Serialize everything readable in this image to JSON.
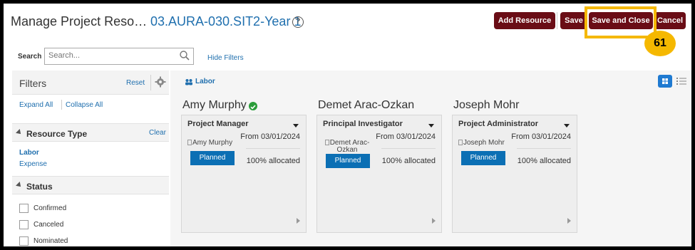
{
  "header": {
    "title": "Manage Project Reso…",
    "project": "03.AURA-030.SIT2-Year 1",
    "help_glyph": "?",
    "buttons": {
      "add_resource": "Add Resource",
      "save": "Save",
      "save_and_close": "Save and Close",
      "cancel": "Cancel"
    },
    "callout_number": "61",
    "accent_color": "#6a0d16",
    "highlight_color": "#f5b800"
  },
  "search": {
    "label": "Search",
    "placeholder": "Search...",
    "hide_filters": "Hide Filters"
  },
  "filters": {
    "title": "Filters",
    "reset": "Reset",
    "expand_all": "Expand All",
    "collapse_all": "Collapse All",
    "resource_type": {
      "title": "Resource Type",
      "clear": "Clear",
      "items": [
        "Labor",
        "Expense"
      ]
    },
    "status": {
      "title": "Status",
      "items": [
        "Confirmed",
        "Canceled",
        "Nominated"
      ]
    }
  },
  "main": {
    "tab": "Labor",
    "people": [
      {
        "name": "Amy Murphy",
        "verified": true,
        "role": "Project Manager",
        "from": "From 03/01/2024",
        "photo_alt": "Amy Murphy",
        "status": "Planned",
        "allocation": "100% allocated"
      },
      {
        "name": "Demet Arac-Ozkan",
        "verified": false,
        "role": "Principal Investigator",
        "from": "From 03/01/2024",
        "photo_alt": "Demet Arac-Ozkan",
        "status": "Planned",
        "allocation": "100% allocated"
      },
      {
        "name": "Joseph Mohr",
        "verified": false,
        "role": "Project Administrator",
        "from": "From 03/01/2024",
        "photo_alt": "Joseph Mohr",
        "status": "Planned",
        "allocation": "100% allocated"
      }
    ]
  }
}
